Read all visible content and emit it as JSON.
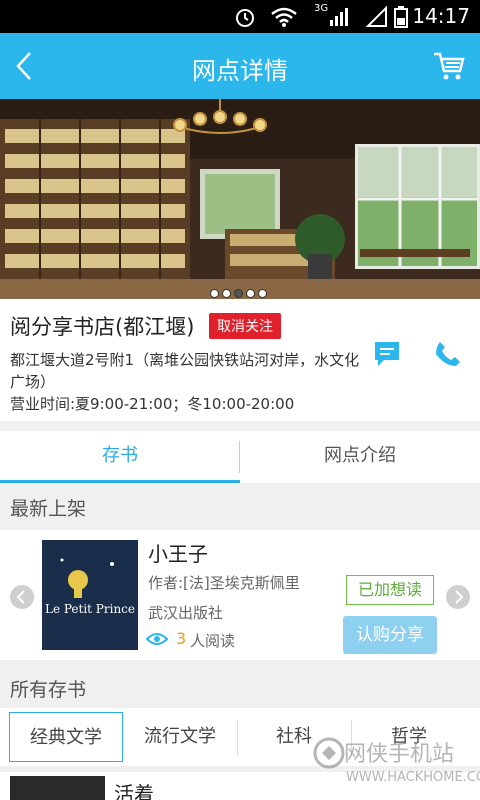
{
  "status_bar": {
    "network": "3G",
    "time": "14:17"
  },
  "header": {
    "title": "网点详情"
  },
  "banner": {
    "slide_count": 5,
    "active_slide": 2
  },
  "store": {
    "name": "阅分享书店(都江堰)",
    "follow_button": "取消关注",
    "address": "都江堰大道2号附1（离堆公园快铁站河对岸，水文化广场）",
    "hours": "营业时间:夏9:00-21:00；冬10:00-20:00"
  },
  "tabs": [
    {
      "label": "存书"
    },
    {
      "label": "网点介绍"
    }
  ],
  "sections": {
    "latest": "最新上架",
    "all_books": "所有存书"
  },
  "featured_book": {
    "title": "小王子",
    "author": "作者:[法]圣埃克斯佩里",
    "publisher": "武汉出版社",
    "read_count": "3",
    "read_suffix": "人阅读",
    "wanted_label": "已加想读",
    "borrow_label": "认购分享",
    "cover_text": "Le Petit Prince"
  },
  "categories": [
    {
      "label": "经典文学"
    },
    {
      "label": "流行文学"
    },
    {
      "label": "社科"
    },
    {
      "label": "哲学"
    }
  ],
  "bottom_book": {
    "title": "活着"
  },
  "watermark": {
    "text": "网侠手机站",
    "url": "WWW.HACKHOME.COM"
  },
  "colors": {
    "accent": "#2bb6ec",
    "danger": "#e0202a",
    "green": "#5cae3a",
    "orange": "#f39c12"
  }
}
